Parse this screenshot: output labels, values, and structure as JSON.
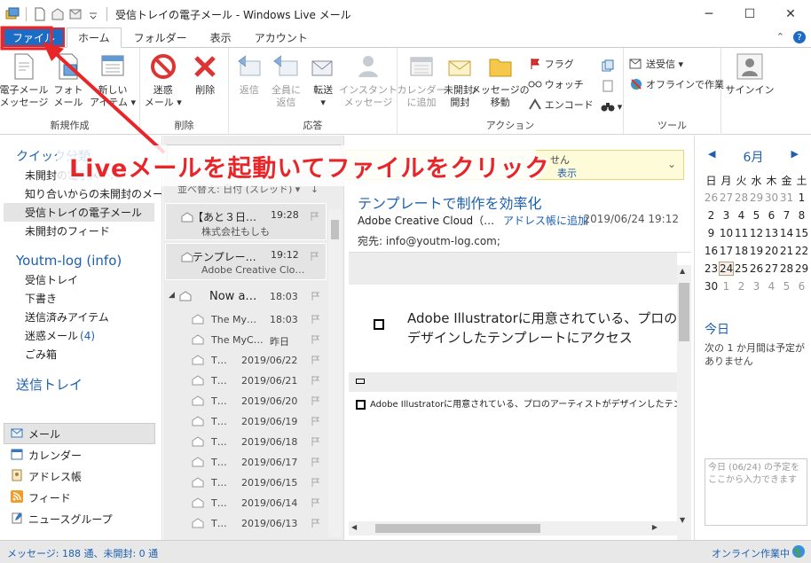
{
  "window": {
    "title": "受信トレイの電子メール - Windows Live メール",
    "minimize_glyph": "─",
    "maximize_glyph": "☐",
    "close_glyph": "✕"
  },
  "ribbon_tabs": {
    "file": "ファイル",
    "home": "ホーム",
    "folder": "フォルダー",
    "view": "表示",
    "account": "アカウント",
    "collapse_glyph": "⌃",
    "help_glyph": "?"
  },
  "ribbon": {
    "new_group": {
      "label": "新規作成",
      "email_message": "電子メール\nメッセージ",
      "photo_mail": "フォト\nメール",
      "new_items": "新しい\nアイテム ▾"
    },
    "delete_group": {
      "label": "削除",
      "junk": "迷惑\nメール ▾",
      "delete": "削除"
    },
    "respond_group": {
      "label": "応答",
      "reply": "返信",
      "reply_all": "全員に\n返信",
      "forward": "転送\n▾",
      "instant_message": "インスタント\nメッセージ"
    },
    "actions_group": {
      "label": "アクション",
      "add_to_calendar": "カレンダー\nに追加",
      "unread_read": "未開封/\n開封",
      "move_message": "メッセージの\n移動",
      "flag": "フラグ",
      "watch": "ウォッチ",
      "encode": "エンコード"
    },
    "tools_group": {
      "label": "ツール",
      "send_receive": "送受信 ▾",
      "work_offline": "オフラインで作業"
    },
    "signin": "サインイン"
  },
  "left_nav": {
    "quick_views_header": "クイック分類",
    "quick_views": [
      "未開封の電子メール",
      "知り合いからの未開封のメール",
      "受信トレイの電子メール",
      "未開封のフィード"
    ],
    "selected_quick_view": 2,
    "account_header": "Youtm-log (info)",
    "folders": [
      {
        "name": "受信トレイ",
        "count": ""
      },
      {
        "name": "下書き",
        "count": ""
      },
      {
        "name": "送信済みアイテム",
        "count": ""
      },
      {
        "name": "迷惑メール",
        "count": "(4)"
      },
      {
        "name": "ごみ箱",
        "count": ""
      }
    ],
    "outbox_header": "送信トレイ",
    "modules": [
      "メール",
      "カレンダー",
      "アドレス帳",
      "フィード",
      "ニュースグループ"
    ]
  },
  "message_list": {
    "sort_label": "並べ替え: 日付 (スレッド) ▾",
    "sort_arrow": "↓",
    "messages": [
      {
        "subject": "【あと３日…",
        "time": "19:28",
        "from": "株式会社もしも"
      },
      {
        "subject": "テンプレー…",
        "time": "19:12",
        "from": "Adobe Creative Clo…"
      }
    ],
    "thread_header": {
      "subject": "Now a…",
      "time": "18:03",
      "expand_glyph": "◢"
    },
    "thread_items": [
      {
        "subject": "The My…",
        "date": "18:03"
      },
      {
        "subject": "The MyC…",
        "date": "昨日"
      },
      {
        "subject": "T…",
        "date": "2019/06/22"
      },
      {
        "subject": "T…",
        "date": "2019/06/21"
      },
      {
        "subject": "T…",
        "date": "2019/06/20"
      },
      {
        "subject": "T…",
        "date": "2019/06/19"
      },
      {
        "subject": "T…",
        "date": "2019/06/18"
      },
      {
        "subject": "T…",
        "date": "2019/06/17"
      },
      {
        "subject": "T…",
        "date": "2019/06/15"
      },
      {
        "subject": "T…",
        "date": "2019/06/14"
      },
      {
        "subject": "T…",
        "date": "2019/06/13"
      }
    ]
  },
  "reading_pane": {
    "infobar_text": "せん",
    "infobar_link": "表示",
    "infobar_chevron": "⌄",
    "subject": "テンプレートで制作を効率化",
    "from": "Adobe Creative Cloud（…",
    "add_to_contacts": "アドレス帳に追加",
    "date": "2019/06/24 19:12",
    "to": "宛先: info@youtm-log.com;",
    "body_large": "Adobe Illustratorに用意されている、プロのデザインしたテンプレートにアクセス",
    "body_small": "Adobe Illustratorに用意されている、プロのアーティストがデザインしたテンプレートにアクセス",
    "scroll_up": "▲",
    "scroll_down": "▼",
    "scroll_left": "◀",
    "scroll_right": "▶"
  },
  "calendar": {
    "month": "6月",
    "prev": "◀",
    "next": "▶",
    "weekdays": [
      "日",
      "月",
      "火",
      "水",
      "木",
      "金",
      "土"
    ],
    "weeks": [
      [
        "26",
        "27",
        "28",
        "29",
        "30",
        "31",
        "1"
      ],
      [
        "2",
        "3",
        "4",
        "5",
        "6",
        "7",
        "8"
      ],
      [
        "9",
        "10",
        "11",
        "12",
        "13",
        "14",
        "15"
      ],
      [
        "16",
        "17",
        "18",
        "19",
        "20",
        "21",
        "22"
      ],
      [
        "23",
        "24",
        "25",
        "26",
        "27",
        "28",
        "29"
      ],
      [
        "30",
        "1",
        "2",
        "3",
        "4",
        "5",
        "6"
      ]
    ],
    "today_label": "今日",
    "today_text": "次の 1 か月間は予定がありません",
    "quick_add_placeholder": "今日 (06/24) の予定をここから入力できます"
  },
  "status_bar": {
    "left": "メッセージ: 188 通、未開封: 0 通",
    "right": "オンライン作業中"
  },
  "annotation": {
    "text": "Liveメールを起動いてファイルをクリック",
    "color": "#e8262a"
  },
  "colors": {
    "accent": "#1c6bc4",
    "link": "#1d5fae",
    "annotation_red": "#e8262a"
  }
}
